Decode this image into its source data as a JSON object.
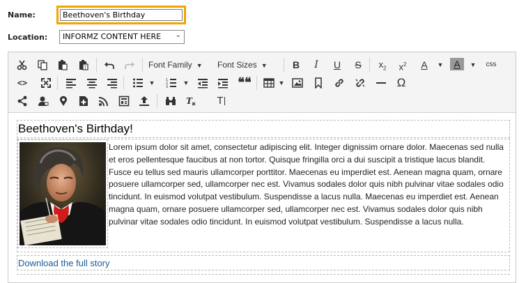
{
  "form": {
    "name_label": "Name:",
    "name_value": "Beethoven's Birthday",
    "location_label": "Location:",
    "location_value": "INFORMZ CONTENT HERE"
  },
  "toolbar": {
    "font_family": "Font Family",
    "font_sizes": "Font Sizes",
    "bold": "B",
    "italic": "I",
    "underline": "U",
    "strike": "S",
    "subscript_base": "x",
    "subscript_mark": "2",
    "superscript_base": "x",
    "superscript_mark": "2",
    "text_color": "A",
    "bg_color": "A",
    "css": "css",
    "source_code": "<>",
    "quote": "❝❝",
    "omega": "Ω",
    "tx": "T"
  },
  "content": {
    "heading": "Beethoven's Birthday!",
    "body": "Lorem ipsum dolor sit amet, consectetur adipiscing elit. Integer dignissim ornare dolor. Maecenas sed nulla et eros pellentesque faucibus at non tortor. Quisque fringilla orci a dui suscipit a tristique lacus blandit. Fusce eu tellus sed mauris ullamcorper porttitor. Maecenas eu imperdiet est. Aenean magna quam, ornare posuere ullamcorper sed, ullamcorper nec est. Vivamus sodales dolor quis nibh pulvinar vitae sodales odio tincidunt. In euismod volutpat vestibulum. Suspendisse a lacus nulla. Maecenas eu imperdiet est. Aenean magna quam, ornare posuere ullamcorper sed, ullamcorper nec est. Vivamus sodales dolor quis nibh pulvinar vitae sodales odio tincidunt. In euismod volutpat vestibulum. Suspendisse a lacus nulla.",
    "link": "Download the full story"
  },
  "colors": {
    "highlight_border": "#f0a500",
    "link": "#1a5a9a"
  }
}
